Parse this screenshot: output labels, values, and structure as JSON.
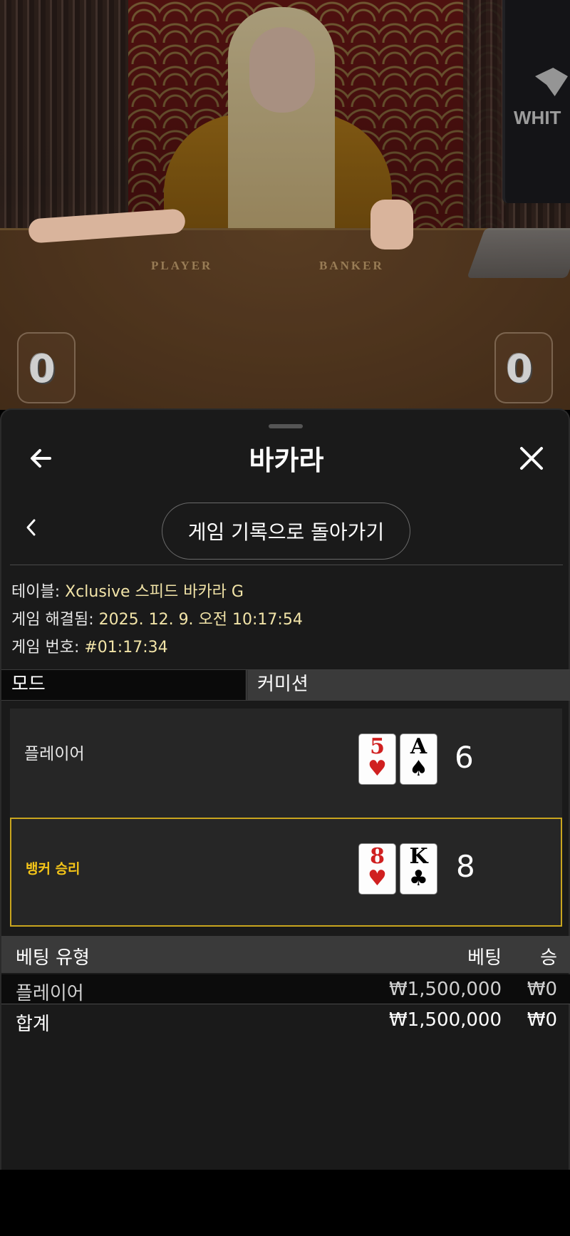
{
  "video": {
    "table_labels": {
      "player": "PLAYER",
      "banker": "BANKER"
    },
    "monitor_text": "WHIT",
    "player_score": "0",
    "banker_score": "0"
  },
  "header": {
    "title": "바카라",
    "back_icon": "arrow-left-icon",
    "close_icon": "close-icon"
  },
  "nav": {
    "chevron_icon": "chevron-left-icon",
    "history_button": "게임 기록으로 돌아가기"
  },
  "info": {
    "table_label": "테이블:",
    "table_value": "Xclusive 스피드 바카라 G",
    "resolved_label": "게임 해결됨:",
    "resolved_value": "2025. 12. 9. 오전 10:17:54",
    "number_label": "게임 번호:",
    "number_value": "#01:17:34"
  },
  "mode": {
    "mode_label": "모드",
    "mode_value": "커미션"
  },
  "results": {
    "player": {
      "label": "플레이어",
      "cards": [
        {
          "rank": "5",
          "suit": "♥"
        },
        {
          "rank": "A",
          "suit": "♠"
        }
      ],
      "total": "6"
    },
    "banker": {
      "label": "뱅커 승리",
      "cards": [
        {
          "rank": "8",
          "suit": "♥"
        },
        {
          "rank": "K",
          "suit": "♣"
        }
      ],
      "total": "8"
    },
    "highlight_color": "#c9a51e"
  },
  "bets": {
    "headers": {
      "type": "베팅 유형",
      "bet": "베팅",
      "win": "승"
    },
    "rows": [
      {
        "type": "플레이어",
        "bet": "₩1,500,000",
        "win": "₩0"
      }
    ],
    "total": {
      "type": "합계",
      "bet": "₩1,500,000",
      "win": "₩0"
    }
  }
}
